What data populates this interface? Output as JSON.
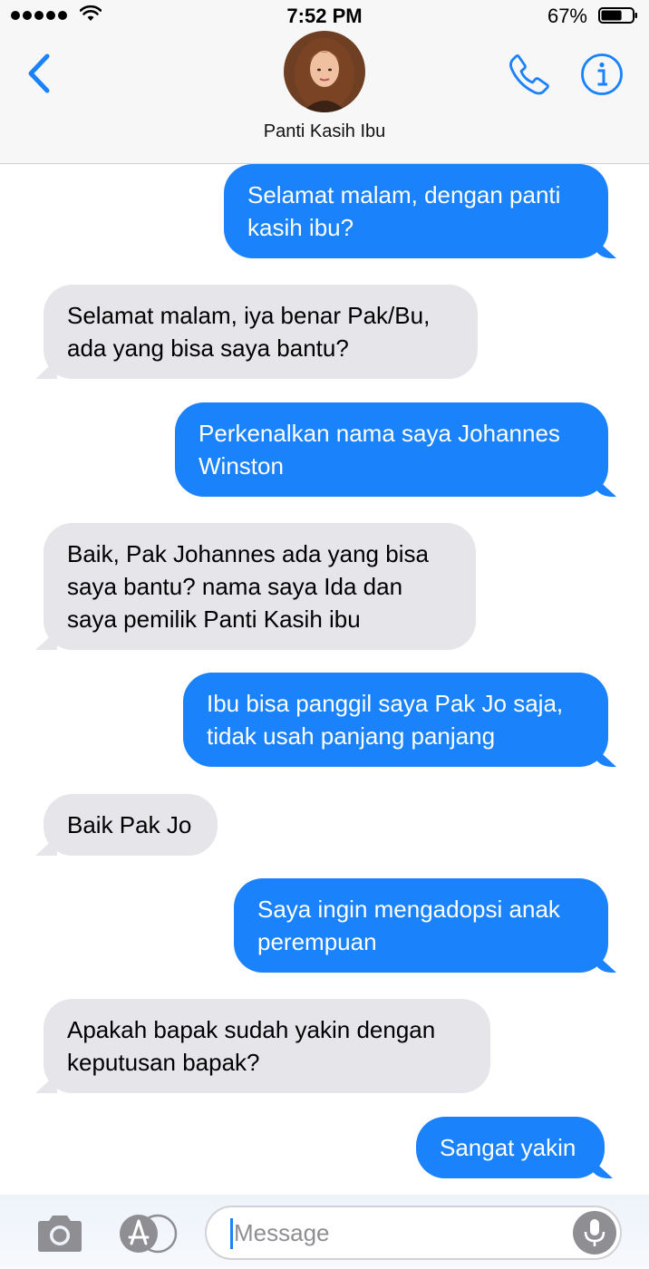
{
  "status_bar": {
    "time": "7:52 PM",
    "battery_percent": "67%",
    "battery_level": 0.67,
    "signal_bars": 5,
    "icons": [
      "signal-icon",
      "wifi-icon",
      "battery-icon"
    ]
  },
  "header": {
    "contact_name": "Panti Kasih Ibu",
    "icons": [
      "back-chevron-icon",
      "avatar",
      "phone-icon",
      "info-icon"
    ],
    "accent_color": "#1a82fb"
  },
  "messages": [
    {
      "from": "me",
      "text": "Selamat malam, dengan panti kasih ibu?"
    },
    {
      "from": "them",
      "text": "Selamat malam, iya benar Pak/Bu, ada yang bisa saya bantu?"
    },
    {
      "from": "me",
      "text": "Perkenalkan nama saya Johannes Winston"
    },
    {
      "from": "them",
      "text": "Baik, Pak Johannes ada yang bisa saya bantu? nama saya Ida dan saya pemilik Panti Kasih ibu"
    },
    {
      "from": "me",
      "text": "Ibu bisa panggil saya Pak Jo saja, tidak usah panjang panjang"
    },
    {
      "from": "them",
      "text": "Baik Pak Jo"
    },
    {
      "from": "me",
      "text": "Saya ingin mengadopsi anak perempuan"
    },
    {
      "from": "them",
      "text": "Apakah bapak sudah yakin dengan keputusan bapak?"
    },
    {
      "from": "me",
      "text": "Sangat yakin"
    }
  ],
  "colors": {
    "sent_bubble": "#1a82fb",
    "received_bubble": "#e5e5ea"
  },
  "input_bar": {
    "placeholder": "Message",
    "value": "",
    "icons": [
      "camera-icon",
      "app-store-icon",
      "microphone-icon"
    ]
  }
}
